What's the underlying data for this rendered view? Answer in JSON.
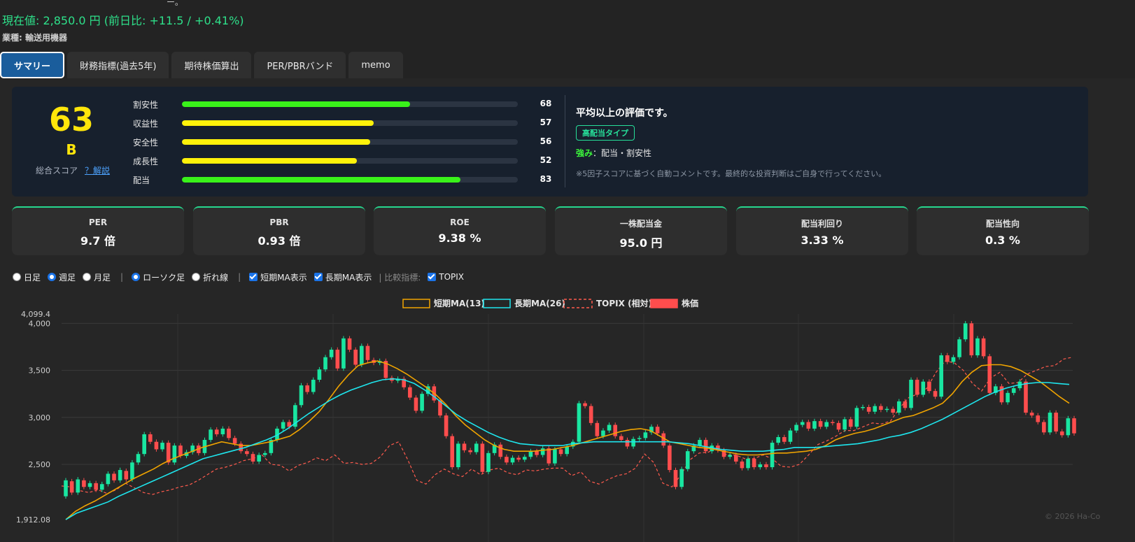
{
  "header": {
    "top_cut": "ー。",
    "price_line": "現在値: 2,850.0 円 (前日比: +11.5 / +0.41%)",
    "industry_line": "業種: 輸送用機器"
  },
  "tabs": [
    {
      "label": "サマリー",
      "active": true
    },
    {
      "label": "財務指標(過去5年)"
    },
    {
      "label": "期待株価算出"
    },
    {
      "label": "PER/PBRバンド"
    },
    {
      "label": "memo"
    }
  ],
  "score": {
    "total": "63",
    "grade": "B",
    "total_label": "総合スコア",
    "explain_link": "？解説",
    "factors": [
      {
        "label": "割安性",
        "value": 68,
        "color": "#39f21a"
      },
      {
        "label": "収益性",
        "value": 57,
        "color": "#fff20a"
      },
      {
        "label": "安全性",
        "value": 56,
        "color": "#fff20a"
      },
      {
        "label": "成長性",
        "value": 52,
        "color": "#fff20a"
      },
      {
        "label": "配当",
        "value": 83,
        "color": "#39f21a"
      }
    ],
    "comment": "平均以上の評価です。",
    "badge": "高配当タイプ",
    "strength_label": "強み",
    "strength_text": "：配当・割安性",
    "note": "※5因子スコアに基づく自動コメントです。最終的な投資判断はご自身で行ってください。"
  },
  "metrics": [
    {
      "label": "PER",
      "value": "9.7 倍"
    },
    {
      "label": "PBR",
      "value": "0.93 倍"
    },
    {
      "label": "ROE",
      "value": "9.38 %"
    },
    {
      "label": "一株配当金",
      "value": "95.0 円"
    },
    {
      "label": "配当利回り",
      "value": "3.33 %"
    },
    {
      "label": "配当性向",
      "value": "0.3 %"
    }
  ],
  "controls": {
    "period": [
      {
        "label": "日足",
        "checked": false
      },
      {
        "label": "週足",
        "checked": true
      },
      {
        "label": "月足",
        "checked": false
      }
    ],
    "style": [
      {
        "label": "ローソク足",
        "checked": true
      },
      {
        "label": "折れ線",
        "checked": false
      }
    ],
    "short_ma": "短期MA表示",
    "long_ma": "長期MA表示",
    "compare_label": "比較指標:",
    "topix": "TOPIX",
    "sep": "|"
  },
  "chart_data": {
    "type": "line",
    "legend": [
      "短期MA(13)",
      "長期MA(26)",
      "TOPIX (相対)",
      "株価"
    ],
    "colors": {
      "short_ma": "#f0a400",
      "long_ma": "#1ee6ee",
      "topix": "#ff5a4d",
      "up": "#19e6a1",
      "down": "#ff4d4d"
    },
    "ylim": [
      1912.08,
      4099.4
    ],
    "ytick_labels": [
      "4,099.4",
      "4,000",
      "3,500",
      "3,000",
      "2,500",
      "1,912.08"
    ],
    "ytick_values": [
      4099.4,
      4000,
      3500,
      3000,
      2500,
      1912.08
    ],
    "copyright": "© 2026 Ha-Co",
    "candles": [
      [
        2160,
        2330
      ],
      [
        2320,
        2200
      ],
      [
        2200,
        2340
      ],
      [
        2330,
        2260
      ],
      [
        2260,
        2300
      ],
      [
        2300,
        2230
      ],
      [
        2230,
        2290
      ],
      [
        2290,
        2400
      ],
      [
        2400,
        2330
      ],
      [
        2330,
        2440
      ],
      [
        2430,
        2340
      ],
      [
        2340,
        2520
      ],
      [
        2520,
        2610
      ],
      [
        2610,
        2820
      ],
      [
        2820,
        2740
      ],
      [
        2740,
        2660
      ],
      [
        2660,
        2730
      ],
      [
        2730,
        2520
      ],
      [
        2520,
        2700
      ],
      [
        2700,
        2590
      ],
      [
        2590,
        2630
      ],
      [
        2630,
        2700
      ],
      [
        2700,
        2620
      ],
      [
        2620,
        2760
      ],
      [
        2760,
        2870
      ],
      [
        2870,
        2820
      ],
      [
        2820,
        2880
      ],
      [
        2880,
        2780
      ],
      [
        2780,
        2720
      ],
      [
        2720,
        2640
      ],
      [
        2640,
        2610
      ],
      [
        2610,
        2530
      ],
      [
        2530,
        2600
      ],
      [
        2600,
        2620
      ],
      [
        2620,
        2760
      ],
      [
        2760,
        2880
      ],
      [
        2880,
        2950
      ],
      [
        2950,
        2900
      ],
      [
        2900,
        3130
      ],
      [
        3130,
        3340
      ],
      [
        3340,
        3270
      ],
      [
        3270,
        3400
      ],
      [
        3400,
        3510
      ],
      [
        3510,
        3640
      ],
      [
        3640,
        3720
      ],
      [
        3720,
        3520
      ],
      [
        3520,
        3840
      ],
      [
        3840,
        3720
      ],
      [
        3720,
        3560
      ],
      [
        3560,
        3760
      ],
      [
        3760,
        3610
      ],
      [
        3610,
        3580
      ],
      [
        3580,
        3600
      ],
      [
        3600,
        3420
      ],
      [
        3420,
        3390
      ],
      [
        3390,
        3410
      ],
      [
        3410,
        3320
      ],
      [
        3320,
        3210
      ],
      [
        3210,
        3070
      ],
      [
        3070,
        3250
      ],
      [
        3250,
        3330
      ],
      [
        3330,
        3180
      ],
      [
        3180,
        3020
      ],
      [
        3020,
        2800
      ],
      [
        2800,
        2470
      ],
      [
        2470,
        2720
      ],
      [
        2720,
        2650
      ],
      [
        2650,
        2630
      ],
      [
        2630,
        2720
      ],
      [
        2720,
        2420
      ],
      [
        2420,
        2620
      ],
      [
        2620,
        2710
      ],
      [
        2710,
        2580
      ],
      [
        2580,
        2520
      ],
      [
        2520,
        2570
      ],
      [
        2570,
        2550
      ],
      [
        2550,
        2580
      ],
      [
        2580,
        2640
      ],
      [
        2640,
        2600
      ],
      [
        2600,
        2670
      ],
      [
        2670,
        2510
      ],
      [
        2510,
        2660
      ],
      [
        2660,
        2610
      ],
      [
        2610,
        2690
      ],
      [
        2690,
        2740
      ],
      [
        2740,
        3150
      ],
      [
        3150,
        3120
      ],
      [
        3120,
        2940
      ],
      [
        2940,
        2800
      ],
      [
        2800,
        2860
      ],
      [
        2860,
        2920
      ],
      [
        2920,
        2800
      ],
      [
        2800,
        2760
      ],
      [
        2760,
        2690
      ],
      [
        2690,
        2770
      ],
      [
        2770,
        2780
      ],
      [
        2780,
        2840
      ],
      [
        2840,
        2900
      ],
      [
        2900,
        2830
      ],
      [
        2830,
        2700
      ],
      [
        2700,
        2440
      ],
      [
        2440,
        2260
      ],
      [
        2260,
        2450
      ],
      [
        2450,
        2640
      ],
      [
        2640,
        2700
      ],
      [
        2700,
        2760
      ],
      [
        2760,
        2640
      ],
      [
        2640,
        2700
      ],
      [
        2700,
        2650
      ],
      [
        2650,
        2580
      ],
      [
        2580,
        2600
      ],
      [
        2600,
        2530
      ],
      [
        2530,
        2460
      ],
      [
        2460,
        2560
      ],
      [
        2560,
        2470
      ],
      [
        2470,
        2500
      ],
      [
        2500,
        2470
      ],
      [
        2470,
        2730
      ],
      [
        2730,
        2790
      ],
      [
        2790,
        2740
      ],
      [
        2740,
        2860
      ],
      [
        2860,
        2920
      ],
      [
        2920,
        2950
      ],
      [
        2950,
        2880
      ],
      [
        2880,
        2960
      ],
      [
        2960,
        2900
      ],
      [
        2900,
        2950
      ],
      [
        2950,
        2940
      ],
      [
        2940,
        2870
      ],
      [
        2870,
        2980
      ],
      [
        2980,
        2900
      ],
      [
        2900,
        3100
      ],
      [
        3100,
        3110
      ],
      [
        3110,
        3060
      ],
      [
        3060,
        3120
      ],
      [
        3120,
        3080
      ],
      [
        3080,
        3090
      ],
      [
        3090,
        3050
      ],
      [
        3050,
        3170
      ],
      [
        3170,
        3100
      ],
      [
        3100,
        3400
      ],
      [
        3400,
        3240
      ],
      [
        3240,
        3380
      ],
      [
        3380,
        3280
      ],
      [
        3280,
        3220
      ],
      [
        3220,
        3660
      ],
      [
        3660,
        3590
      ],
      [
        3590,
        3640
      ],
      [
        3640,
        3830
      ],
      [
        3830,
        4000
      ],
      [
        4000,
        3660
      ],
      [
        3660,
        3840
      ],
      [
        3840,
        3650
      ],
      [
        3650,
        3260
      ],
      [
        3260,
        3330
      ],
      [
        3330,
        3160
      ],
      [
        3160,
        3260
      ],
      [
        3260,
        3310
      ],
      [
        3310,
        3380
      ],
      [
        3380,
        3050
      ],
      [
        3050,
        3020
      ],
      [
        3020,
        2950
      ],
      [
        2950,
        2840
      ],
      [
        2840,
        3050
      ],
      [
        3050,
        2850
      ],
      [
        2850,
        2810
      ],
      [
        2810,
        2990
      ],
      [
        2990,
        2830
      ]
    ],
    "short_ma": [
      1912,
      2000,
      2060,
      2110,
      2170,
      2230,
      2290,
      2350,
      2400,
      2450,
      2510,
      2560,
      2600,
      2640,
      2680,
      2710,
      2740,
      2720,
      2700,
      2700,
      2720,
      2740,
      2770,
      2800,
      2870,
      2960,
      3060,
      3190,
      3330,
      3450,
      3550,
      3580,
      3600,
      3570,
      3520,
      3460,
      3390,
      3320,
      3240,
      3140,
      3020,
      2920,
      2840,
      2760,
      2700,
      2660,
      2640,
      2640,
      2640,
      2650,
      2660,
      2680,
      2700,
      2730,
      2760,
      2790,
      2820,
      2850,
      2870,
      2880,
      2860,
      2800,
      2740,
      2720,
      2700,
      2680,
      2670,
      2650,
      2630,
      2610,
      2600,
      2600,
      2610,
      2620,
      2620,
      2630,
      2640,
      2660,
      2700,
      2760,
      2800,
      2830,
      2850,
      2880,
      2920,
      2960,
      3000,
      3020,
      3060,
      3100,
      3150,
      3250,
      3380,
      3480,
      3550,
      3560,
      3560,
      3540,
      3500,
      3440,
      3380,
      3300,
      3220,
      3150
    ],
    "long_ma": [
      1912,
      1980,
      2020,
      2060,
      2100,
      2160,
      2210,
      2260,
      2310,
      2360,
      2410,
      2460,
      2510,
      2560,
      2590,
      2620,
      2650,
      2680,
      2720,
      2760,
      2810,
      2880,
      2960,
      3040,
      3110,
      3180,
      3240,
      3290,
      3330,
      3370,
      3400,
      3410,
      3400,
      3360,
      3290,
      3210,
      3120,
      3030,
      2960,
      2900,
      2840,
      2790,
      2750,
      2720,
      2710,
      2700,
      2700,
      2700,
      2720,
      2730,
      2740,
      2740,
      2740,
      2740,
      2740,
      2740,
      2740,
      2740,
      2730,
      2720,
      2700,
      2680,
      2660,
      2650,
      2640,
      2640,
      2640,
      2650,
      2660,
      2680,
      2680,
      2680,
      2690,
      2700,
      2710,
      2720,
      2740,
      2760,
      2790,
      2810,
      2840,
      2880,
      2930,
      2980,
      3040,
      3100,
      3160,
      3220,
      3270,
      3310,
      3340,
      3360,
      3370,
      3370,
      3360,
      3350
    ],
    "topix": [
      2270,
      2260,
      2220,
      2200,
      2230,
      2190,
      2230,
      2300,
      2250,
      2200,
      2180,
      2210,
      2230,
      2260,
      2280,
      2330,
      2390,
      2450,
      2470,
      2500,
      2540,
      2560,
      2600,
      2500,
      2490,
      2430,
      2490,
      2520,
      2570,
      2540,
      2600,
      2510,
      2520,
      2500,
      2510,
      2580,
      2700,
      2740,
      2550,
      2330,
      2290,
      2390,
      2450,
      2400,
      2370,
      2450,
      2390,
      2440,
      2460,
      2410,
      2390,
      2440,
      2430,
      2450,
      2460,
      2460,
      2380,
      2420,
      2320,
      2290,
      2340,
      2380,
      2400,
      2460,
      2610,
      2520,
      2300,
      2260,
      2390,
      2550,
      2620,
      2630,
      2680,
      2600,
      2600,
      2560,
      2560,
      2600,
      2560,
      2480,
      2470,
      2500,
      2600,
      2710,
      2750,
      2800,
      2860,
      2860,
      2900,
      2940,
      2930,
      2960,
      3100,
      3210,
      3250,
      3310,
      3480,
      3600,
      3580,
      3500,
      3360,
      3280,
      3420,
      3480,
      3360,
      3370,
      3460,
      3500,
      3540,
      3550,
      3620,
      3640
    ]
  }
}
